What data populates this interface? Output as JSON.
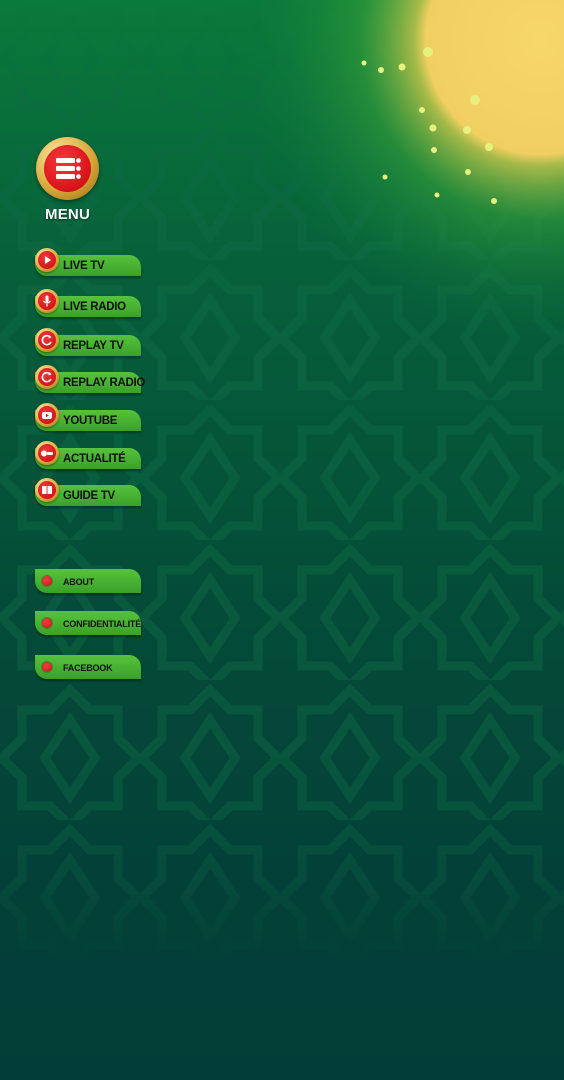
{
  "menu": {
    "label": "MENU",
    "icon": "list-menu-icon"
  },
  "nav_items": [
    {
      "label": "LIVE TV",
      "icon": "play-icon"
    },
    {
      "label": "LIVE RADIO",
      "icon": "microphone-icon"
    },
    {
      "label": "REPLAY TV",
      "icon": "replay-icon"
    },
    {
      "label": "REPLAY RADIO",
      "icon": "replay-icon"
    },
    {
      "label": "YOUTUBE",
      "icon": "youtube-icon"
    },
    {
      "label": "ACTUALITÉ",
      "icon": "news-icon"
    },
    {
      "label": "GUIDE TV",
      "icon": "book-icon"
    }
  ],
  "secondary_items": [
    {
      "label": "ABOUT"
    },
    {
      "label": "CONFIDENTIALITÉ"
    },
    {
      "label": "FACEBOOK"
    }
  ],
  "colors": {
    "background_top": "#0a7a3a",
    "background_bottom": "#033d37",
    "button_green": "#4cb535",
    "accent_red": "#d8121a",
    "gold": "#d9a93a",
    "glow": "#f5d067"
  }
}
